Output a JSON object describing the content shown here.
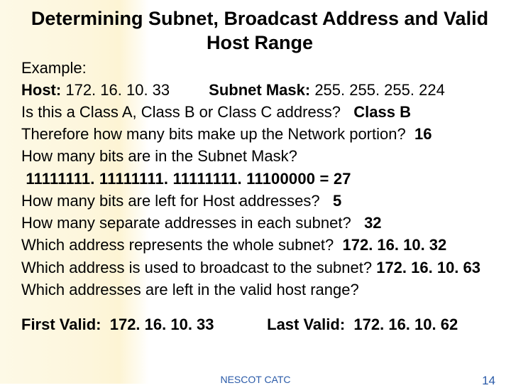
{
  "title": "Determining Subnet, Broadcast Address and Valid Host Range",
  "example_label": "Example:",
  "host_label": "Host:",
  "host_value": "172. 16. 10. 33",
  "mask_label": "Subnet Mask:",
  "mask_value": "255. 255. 255. 224",
  "q_class": "Is this a Class A, Class B or Class C address?",
  "a_class": "Class B",
  "q_netbits": "Therefore how many bits make up the Network portion?",
  "a_netbits": "16",
  "q_maskbits": "How many bits are in the Subnet Mask?",
  "maskbits_binary": "11111111. 11111111. 11111111. 11100000 = 27",
  "q_hostbits": "How many bits are left for Host addresses?",
  "a_hostbits": "5",
  "q_sepaddr": "How many separate addresses in each subnet?",
  "a_sepaddr": "32",
  "q_subnet": "Which address represents the whole subnet?",
  "a_subnet": "172. 16. 10. 32",
  "q_broadcast": "Which address is used to broadcast to the subnet?",
  "a_broadcast": "172. 16. 10. 63",
  "q_validrange": "Which addresses are left in the valid host range?",
  "first_label": "First Valid:",
  "first_value": "172. 16. 10. 33",
  "last_label": "Last Valid:",
  "last_value": "172. 16. 10. 62",
  "footer_org": "NESCOT CATC",
  "footer_page": "14"
}
